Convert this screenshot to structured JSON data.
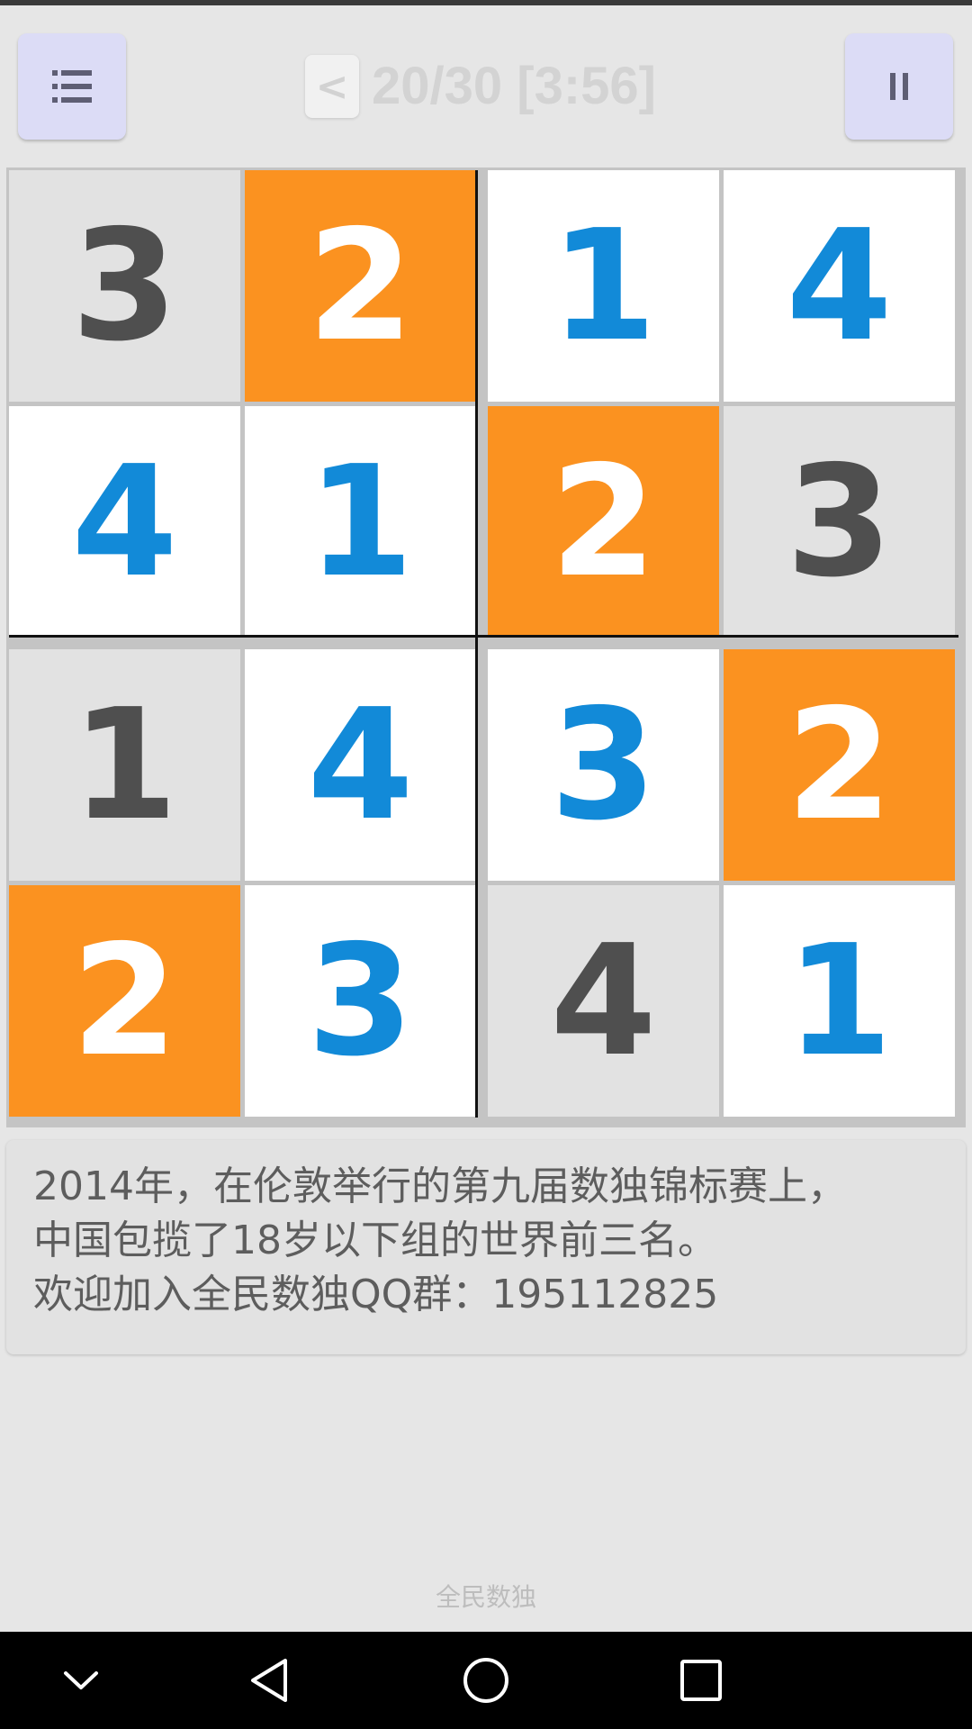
{
  "header": {
    "back_label": "<",
    "status": "20/30 [3:56]",
    "menu_icon": "menu-list-icon",
    "pause_icon": "pause-icon"
  },
  "board": {
    "size": 4,
    "cells": [
      [
        {
          "v": "3",
          "kind": "given"
        },
        {
          "v": "2",
          "kind": "highlight"
        },
        {
          "v": "1",
          "kind": "entry"
        },
        {
          "v": "4",
          "kind": "entry"
        }
      ],
      [
        {
          "v": "4",
          "kind": "entry"
        },
        {
          "v": "1",
          "kind": "entry"
        },
        {
          "v": "2",
          "kind": "highlight"
        },
        {
          "v": "3",
          "kind": "given"
        }
      ],
      [
        {
          "v": "1",
          "kind": "given"
        },
        {
          "v": "4",
          "kind": "entry"
        },
        {
          "v": "3",
          "kind": "entry"
        },
        {
          "v": "2",
          "kind": "highlight"
        }
      ],
      [
        {
          "v": "2",
          "kind": "highlight"
        },
        {
          "v": "3",
          "kind": "entry"
        },
        {
          "v": "4",
          "kind": "given"
        },
        {
          "v": "1",
          "kind": "entry"
        }
      ]
    ]
  },
  "tip": {
    "lines": [
      "2014年，在伦敦举行的第九届数独锦标赛上，",
      "中国包揽了18岁以下组的世界前三名。",
      "欢迎加入全民数独QQ群：195112825"
    ]
  },
  "footer": {
    "app_name": "全民数独"
  },
  "colors": {
    "highlight": "#fb9220",
    "entry_digit": "#128ad8",
    "given_digit": "#4f4f4f",
    "button": "#dcdcf6"
  },
  "navbar": {
    "icons": [
      "chevron-down-icon",
      "back-triangle-icon",
      "home-circle-icon",
      "recents-square-icon"
    ]
  }
}
